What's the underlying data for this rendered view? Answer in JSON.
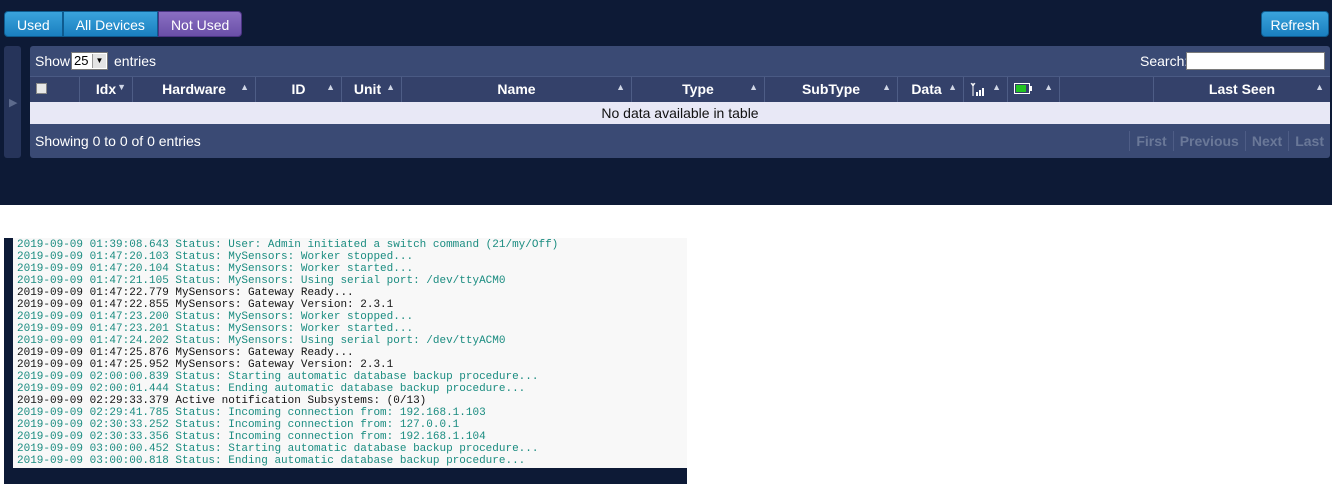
{
  "filters": {
    "used_label": "Used",
    "all_label": "All Devices",
    "not_used_label": "Not Used"
  },
  "refresh_label": "Refresh",
  "table": {
    "length_prefix": "Show",
    "length_value": "25",
    "length_suffix": "entries",
    "search_label": "Search:",
    "search_value": "",
    "columns": {
      "idx": "Idx",
      "hardware": "Hardware",
      "id": "ID",
      "unit": "Unit",
      "name": "Name",
      "type": "Type",
      "subtype": "SubType",
      "data": "Data",
      "last_seen": "Last Seen"
    },
    "empty_message": "No data available in table",
    "info": "Showing 0 to 0 of 0 entries",
    "pager": {
      "first": "First",
      "previous": "Previous",
      "next": "Next",
      "last": "Last"
    }
  },
  "icons": {
    "sort": "sort-icon",
    "signal": "signal-icon",
    "battery": "battery-icon",
    "dropdown": "chevron-down-icon",
    "sidebar": "chevron-right-icon"
  },
  "colors": {
    "page_bg": "#0d1a36",
    "button_blue": "#1a7fbf",
    "button_active": "#6a4fa8",
    "log_status": "#1a8c80",
    "log_plain": "#111111"
  },
  "log": [
    {
      "text": "2019-09-09 01:39:08.643 Status: User: Admin initiated a switch command (21/my/Off)",
      "kind": "status"
    },
    {
      "text": "2019-09-09 01:47:20.103 Status: MySensors: Worker stopped...",
      "kind": "status"
    },
    {
      "text": "2019-09-09 01:47:20.104 Status: MySensors: Worker started...",
      "kind": "status"
    },
    {
      "text": "2019-09-09 01:47:21.105 Status: MySensors: Using serial port: /dev/ttyACM0",
      "kind": "status"
    },
    {
      "text": "2019-09-09 01:47:22.779 MySensors: Gateway Ready...",
      "kind": "plain"
    },
    {
      "text": "2019-09-09 01:47:22.855 MySensors: Gateway Version: 2.3.1",
      "kind": "plain"
    },
    {
      "text": "2019-09-09 01:47:23.200 Status: MySensors: Worker stopped...",
      "kind": "status"
    },
    {
      "text": "2019-09-09 01:47:23.201 Status: MySensors: Worker started...",
      "kind": "status"
    },
    {
      "text": "2019-09-09 01:47:24.202 Status: MySensors: Using serial port: /dev/ttyACM0",
      "kind": "status"
    },
    {
      "text": "2019-09-09 01:47:25.876 MySensors: Gateway Ready...",
      "kind": "plain"
    },
    {
      "text": "2019-09-09 01:47:25.952 MySensors: Gateway Version: 2.3.1",
      "kind": "plain"
    },
    {
      "text": "2019-09-09 02:00:00.839 Status: Starting automatic database backup procedure...",
      "kind": "status"
    },
    {
      "text": "2019-09-09 02:00:01.444 Status: Ending automatic database backup procedure...",
      "kind": "status"
    },
    {
      "text": "2019-09-09 02:29:33.379 Active notification Subsystems: (0/13)",
      "kind": "plain"
    },
    {
      "text": "2019-09-09 02:29:41.785 Status: Incoming connection from: 192.168.1.103",
      "kind": "status"
    },
    {
      "text": "2019-09-09 02:30:33.252 Status: Incoming connection from: 127.0.0.1",
      "kind": "status"
    },
    {
      "text": "2019-09-09 02:30:33.356 Status: Incoming connection from: 192.168.1.104",
      "kind": "status"
    },
    {
      "text": "2019-09-09 03:00:00.452 Status: Starting automatic database backup procedure...",
      "kind": "status"
    },
    {
      "text": "2019-09-09 03:00:00.818 Status: Ending automatic database backup procedure...",
      "kind": "status"
    }
  ]
}
